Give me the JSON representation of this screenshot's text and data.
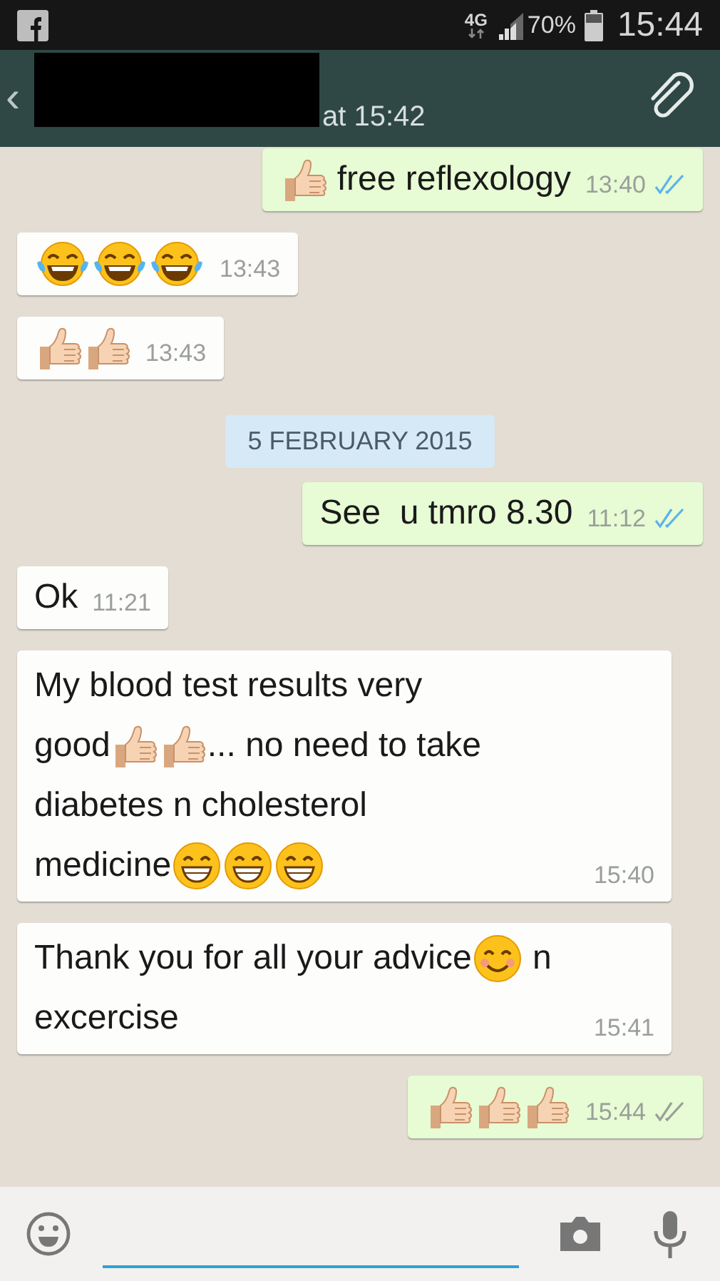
{
  "status_bar": {
    "network": "4G",
    "battery": "70%",
    "time": "15:44"
  },
  "header": {
    "back": "‹",
    "last_seen": "at 15:42"
  },
  "messages": [
    {
      "kind": "bubble",
      "outgoing": true,
      "lines": [
        [
          {
            "kind": "thumbs_up"
          },
          {
            "kind": "text",
            "text": " free reflexology"
          }
        ]
      ],
      "time": "13:40",
      "read": true
    },
    {
      "kind": "bubble",
      "outgoing": false,
      "lines": [
        [
          {
            "kind": "tears_of_joy"
          },
          {
            "kind": "tears_of_joy"
          },
          {
            "kind": "tears_of_joy"
          }
        ]
      ],
      "time": "13:43"
    },
    {
      "kind": "bubble",
      "outgoing": false,
      "lines": [
        [
          {
            "kind": "thumbs_up"
          },
          {
            "kind": "thumbs_up"
          }
        ]
      ],
      "time": "13:43"
    },
    {
      "kind": "date",
      "text": "5 FEBRUARY 2015"
    },
    {
      "kind": "bubble",
      "outgoing": true,
      "lines": [
        [
          {
            "kind": "text",
            "text": "See  u tmro 8.30"
          }
        ]
      ],
      "time": "11:12",
      "read": true
    },
    {
      "kind": "bubble",
      "outgoing": false,
      "lines": [
        [
          {
            "kind": "text",
            "text": "Ok"
          }
        ]
      ],
      "time": "11:21"
    },
    {
      "kind": "bubble",
      "outgoing": false,
      "lines": [
        [
          {
            "kind": "text",
            "text": "My blood test results very"
          }
        ],
        [
          {
            "kind": "text",
            "text": "good"
          },
          {
            "kind": "thumbs_up"
          },
          {
            "kind": "thumbs_up"
          },
          {
            "kind": "text",
            "text": "... no need to take"
          }
        ],
        [
          {
            "kind": "text",
            "text": "diabetes n cholesterol"
          }
        ],
        [
          {
            "kind": "text",
            "text": "medicine"
          },
          {
            "kind": "grin"
          },
          {
            "kind": "grin"
          },
          {
            "kind": "grin"
          }
        ]
      ],
      "time": "15:40"
    },
    {
      "kind": "bubble",
      "outgoing": false,
      "lines": [
        [
          {
            "kind": "text",
            "text": "Thank you for all your advice"
          },
          {
            "kind": "smile"
          },
          {
            "kind": "text",
            "text": " n"
          }
        ],
        [
          {
            "kind": "text",
            "text": "excercise"
          }
        ]
      ],
      "time": "15:41"
    },
    {
      "kind": "bubble",
      "outgoing": true,
      "lines": [
        [
          {
            "kind": "thumbs_up"
          },
          {
            "kind": "thumbs_up"
          },
          {
            "kind": "thumbs_up"
          }
        ]
      ],
      "time": "15:44",
      "read": false
    }
  ]
}
